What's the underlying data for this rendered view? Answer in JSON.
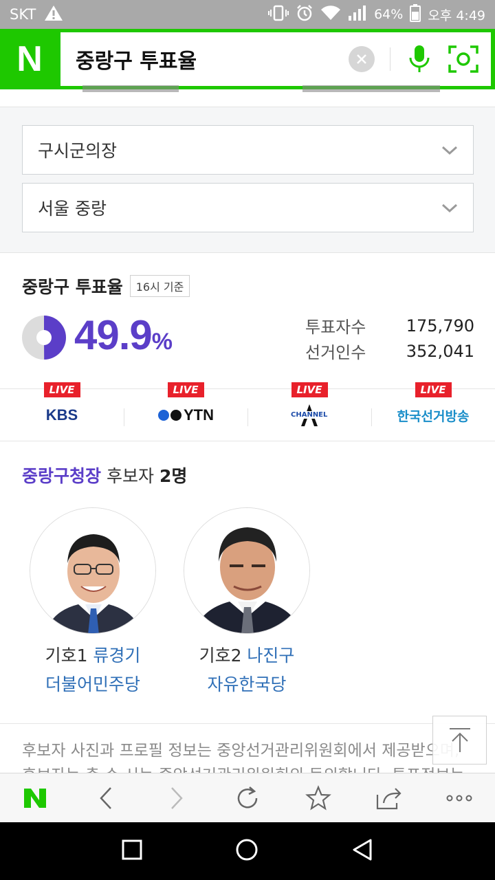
{
  "status_bar": {
    "carrier": "SKT",
    "battery": "64%",
    "time": "오후 4:49"
  },
  "search": {
    "logo": "N",
    "query": "중랑구 투표율"
  },
  "filters": {
    "election_type": "구시군의장",
    "region": "서울 중랑"
  },
  "turnout": {
    "title": "중랑구 투표율",
    "as_of": "16시 기준",
    "percent": "49.9",
    "percent_unit": "%",
    "percent_value": 49.9,
    "voters_label": "투표자수",
    "voters": "175,790",
    "electorate_label": "선거인수",
    "electorate": "352,041",
    "accent_color": "#5b3ec8"
  },
  "live": {
    "badge": "LIVE",
    "channels": [
      "KBS",
      "YTN",
      "CHANNEL",
      "한국선거방송"
    ]
  },
  "candidates": {
    "race": "중랑구청장",
    "label": "후보자",
    "count": "2명",
    "list": [
      {
        "number": "기호1",
        "name": "류경기",
        "party": "더불어민주당"
      },
      {
        "number": "기호2",
        "name": "나진구",
        "party": "자유한국당"
      }
    ]
  },
  "notice": "후보자 사진과 프로필 정보는 중앙선거관리위원회에서 제공받으며, 후보자는 총 수 시는 중앙선거관리위원회의 동의합니다. 투표정보는"
}
